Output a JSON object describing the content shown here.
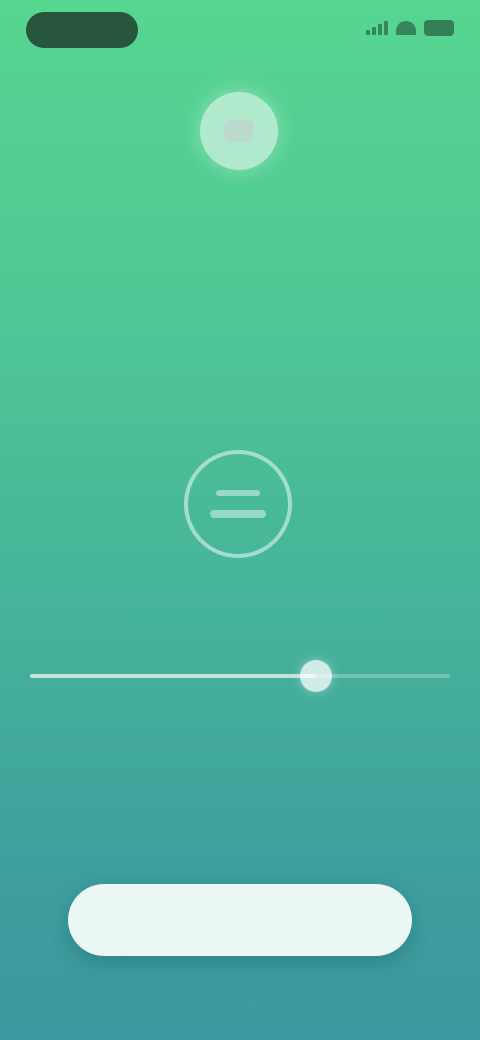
{
  "status_bar": {
    "time": "",
    "signal_icon": "signal-icon",
    "wifi_icon": "wifi-icon",
    "battery_icon": "battery-icon"
  },
  "header": {
    "avatar_icon": "app-avatar-icon",
    "title_line_1": "",
    "title_line_2": ""
  },
  "timer": {
    "icon": "timer-icon",
    "caption": ""
  },
  "slider": {
    "value_fraction": 0.68
  },
  "primary_button": {
    "label": ""
  },
  "colors": {
    "gradient_top": "#57d690",
    "gradient_bottom": "#3b98a0",
    "button_bg": "#eaf7f3",
    "button_text": "#66b7b0"
  }
}
